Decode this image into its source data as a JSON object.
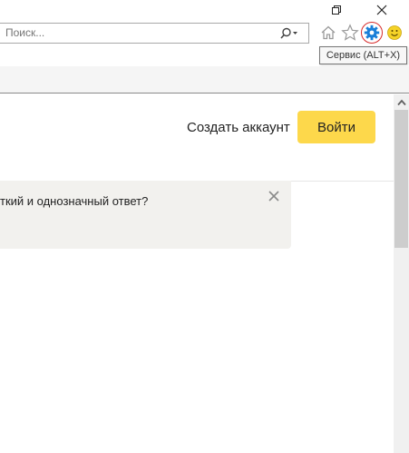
{
  "window": {
    "restore_label": "",
    "close_label": ""
  },
  "toolbar": {
    "search_placeholder": "Поиск...",
    "tooltip": "Сервис (ALT+X)"
  },
  "page": {
    "create_account": "Создать аккаунт",
    "login": "Войти",
    "notice_text": "ткий и однозначный ответ?"
  },
  "colors": {
    "login_button": "#fdd84b",
    "notice_bg": "#f2f1ee",
    "tools_highlight": "#d62b2b",
    "gear_icon": "#1a7fd8"
  },
  "icons": [
    "restore-icon",
    "close-icon",
    "search-icon",
    "chevron-down-icon",
    "home-icon",
    "star-icon",
    "gear-icon",
    "smiley-icon",
    "scroll-up-icon"
  ]
}
